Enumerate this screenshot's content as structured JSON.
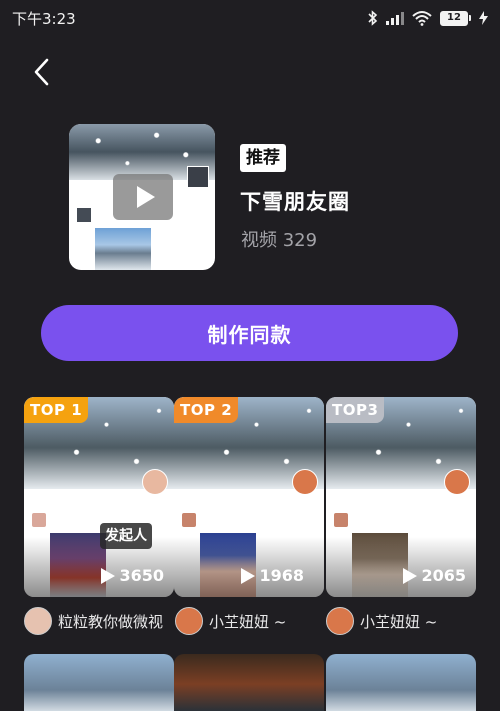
{
  "status_bar": {
    "time": "下午3:23",
    "battery": "12",
    "icons": [
      "bluetooth-icon",
      "signal-icon",
      "wifi-icon",
      "battery-icon",
      "charging-icon"
    ]
  },
  "template": {
    "tag": "推荐",
    "title": "下雪朋友圈",
    "video_count": "视频 329"
  },
  "cta": {
    "label": "制作同款"
  },
  "colors": {
    "background": "#1f1e22",
    "accent": "#7a51ee",
    "top1": "#f5a20f",
    "top2": "#f08a2a",
    "top3": "#b9bcc4"
  },
  "videos": [
    {
      "rank": "TOP 1",
      "plays": "3650",
      "badge": "发起人",
      "author": "粒粒教你做微视"
    },
    {
      "rank": "TOP 2",
      "plays": "1968",
      "author": "小芏妞妞 ~"
    },
    {
      "rank": "TOP3",
      "plays": "2065",
      "author": "小芏妞妞 ~"
    }
  ]
}
